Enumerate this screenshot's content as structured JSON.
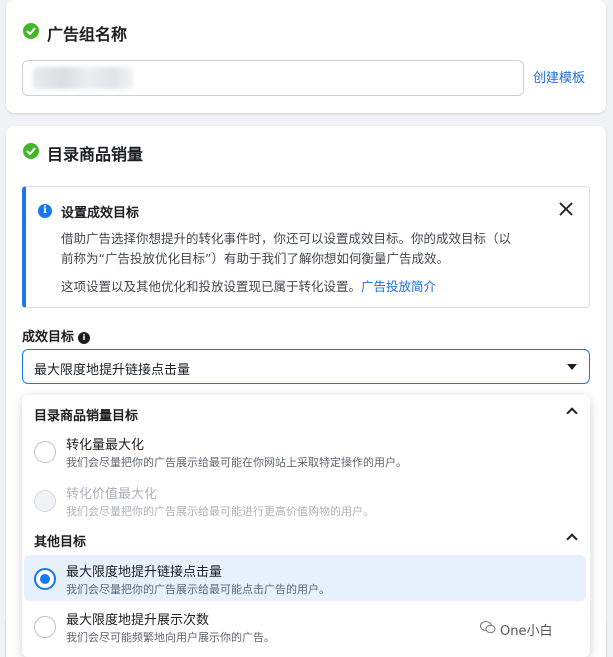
{
  "ad_group": {
    "title": "广告组名称",
    "input_value": "",
    "create_template_link": "创建模板"
  },
  "catalog": {
    "title": "目录商品销量"
  },
  "info": {
    "title": "设置成效目标",
    "line1": "借助广告选择你想提升的转化事件时，你还可以设置成效目标。你的成效目标（以",
    "line2": "前称为“广告投放优化目标”）有助于我们了解你想如何衡量广告成效。",
    "line3": "这项设置以及其他优化和投放设置现已属于转化设置。",
    "link": "广告投放简介"
  },
  "goal": {
    "label": "成效目标",
    "help": "i",
    "selected": "最大限度地提升链接点击量"
  },
  "dropdown": {
    "groups": [
      {
        "title": "目录商品销量目标",
        "options": [
          {
            "title": "转化量最大化",
            "desc": "我们会尽量把你的广告展示给最可能在你网站上采取特定操作的用户。",
            "state": "normal"
          },
          {
            "title": "转化价值最大化",
            "desc": "我们会尽量把你的广告展示给最可能进行更高价值购物的用户。",
            "state": "disabled"
          }
        ]
      },
      {
        "title": "其他目标",
        "options": [
          {
            "title": "最大限度地提升链接点击量",
            "desc": "我们会尽量把你的广告展示给最可能点击广告的用户。",
            "state": "selected"
          },
          {
            "title": "最大限度地提升展示次数",
            "desc": "我们会尽可能频繁地向用户展示你的广告。",
            "state": "normal"
          }
        ]
      }
    ]
  },
  "watermark": "One小白",
  "colors": {
    "accent": "#1877f2",
    "success": "#42b72a",
    "link": "#216fdb",
    "selected_bg": "#e7f0fd"
  },
  "icons": [
    "check-circle-icon",
    "info-icon",
    "close-icon",
    "caret-down-icon",
    "chevron-up-icon",
    "wechat-icon"
  ]
}
